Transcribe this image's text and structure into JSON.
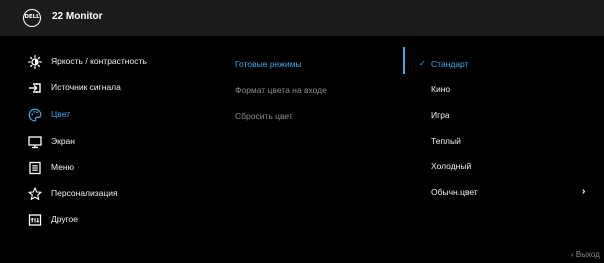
{
  "header": {
    "logo_text": "DELL",
    "title": "22 Monitor"
  },
  "menu": {
    "items": [
      {
        "label": "Яркость / контрастность",
        "icon": "brightness-icon"
      },
      {
        "label": "Источник сигнала",
        "icon": "input-source-icon"
      },
      {
        "label": "Цвет",
        "icon": "palette-icon",
        "active": true
      },
      {
        "label": "Экран",
        "icon": "display-icon"
      },
      {
        "label": "Меню",
        "icon": "menu-icon"
      },
      {
        "label": "Персонализация",
        "icon": "star-icon"
      },
      {
        "label": "Другое",
        "icon": "other-icon"
      }
    ]
  },
  "submenu": {
    "items": [
      {
        "label": "Готовые режимы",
        "state": "active"
      },
      {
        "label": "Формат цвета на входе",
        "state": "dim"
      },
      {
        "label": "Сбросить цвет",
        "state": "dim"
      }
    ]
  },
  "options": {
    "check_mark": "✓",
    "chevron": "›",
    "items": [
      {
        "label": "Стандарт",
        "selected": true
      },
      {
        "label": "Кино"
      },
      {
        "label": "Игра"
      },
      {
        "label": "Теплый"
      },
      {
        "label": "Холодный"
      },
      {
        "label": "Обычн.цвет",
        "has_submenu": true
      }
    ]
  },
  "footer": {
    "exit_label": "‹ Выход"
  },
  "colors": {
    "accent": "#3ea8e6",
    "background": "#000000",
    "header": "#1b1b1d",
    "text": "#f0f0f0",
    "dim_text": "#8e8e8e"
  }
}
